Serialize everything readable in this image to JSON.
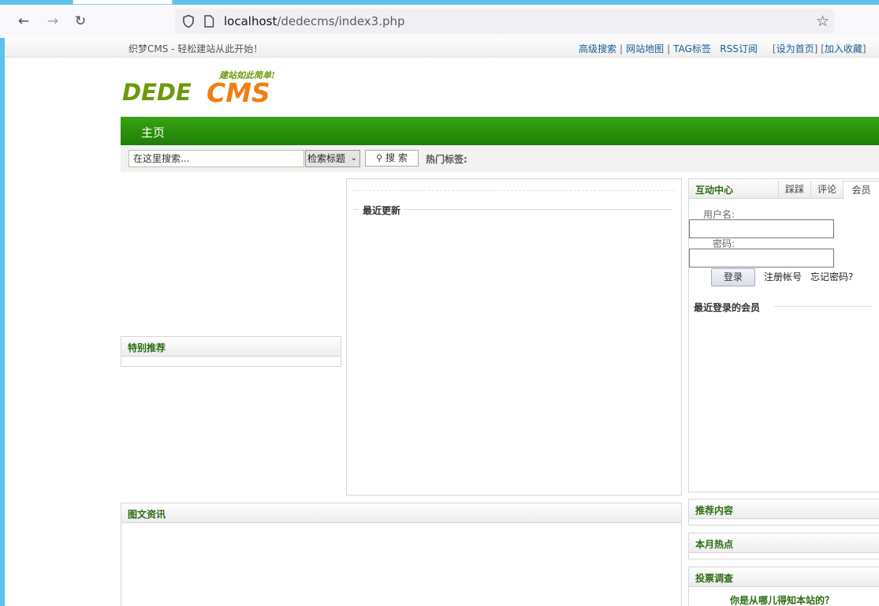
{
  "browser": {
    "url_host": "localhost",
    "url_path": "/dedecms/index3.php"
  },
  "site": {
    "slogan": "织梦CMS - 轻松建站从此开始！",
    "toplinks": [
      "高级搜索",
      "网站地图",
      "TAG标签",
      "RSS订阅"
    ],
    "bracket_links": [
      "设为首页",
      "加入收藏"
    ],
    "logo": {
      "text": "DEDECMS",
      "tagline": "建站如此简单!",
      "color_dede": "#6b9a0c",
      "color_cms": "#ef7f12"
    },
    "nav": {
      "home": "主页",
      "color": "#2a9410"
    },
    "search": {
      "placeholder": "在这里搜索...",
      "select_value": "检索标题",
      "button": "搜 索",
      "hot_tags_label": "热门标签:"
    },
    "left": {
      "special_title": "特别推荐"
    },
    "center": {
      "latest_title": "最近更新"
    },
    "right": {
      "panel_title": "互动中心",
      "tabs": [
        "踩踩",
        "评论",
        "会员"
      ],
      "active_tab": "会员",
      "username_label": "用户名:",
      "password_label": "密码:",
      "login_button": "登录",
      "register_link": "注册帐号",
      "forgot_link": "忘记密码?",
      "recent_members_title": "最近登录的会员"
    },
    "photo_news_title": "图文资讯",
    "recommend_title": "推荐内容",
    "monthly_hot_title": "本月热点",
    "poll": {
      "title": "投票调查",
      "question": "你是从哪儿得知本站的？"
    }
  }
}
